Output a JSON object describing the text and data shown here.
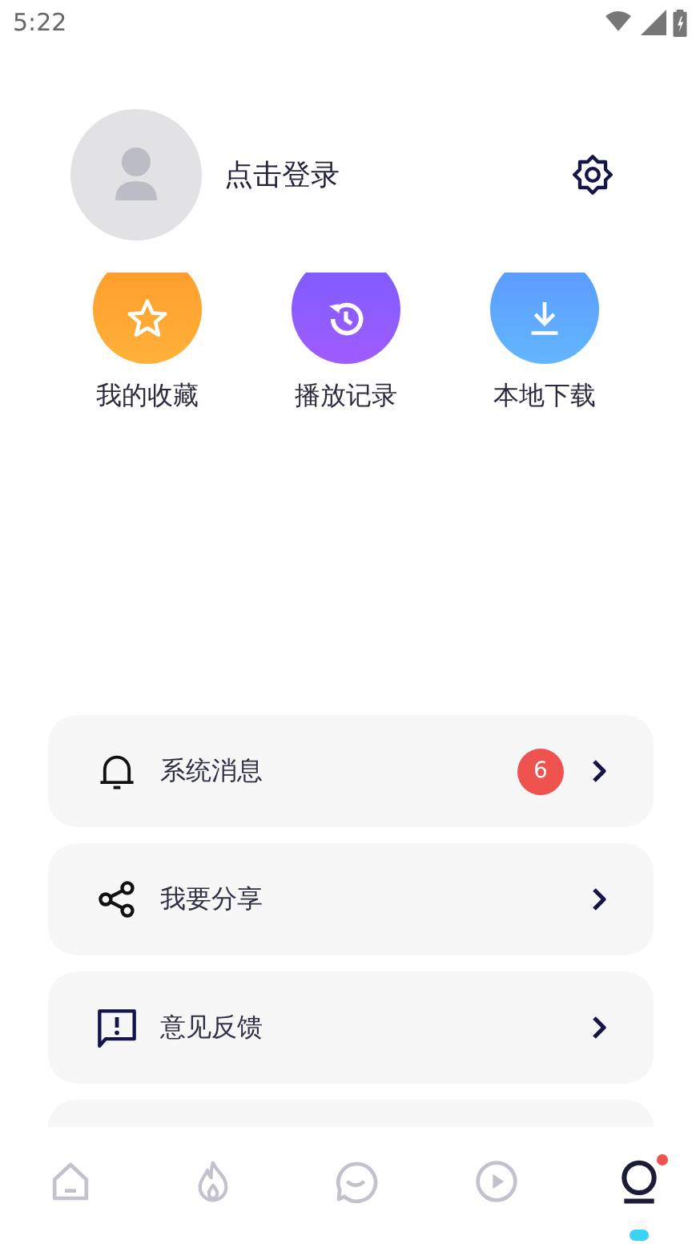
{
  "status_bar": {
    "time": "5:22"
  },
  "profile": {
    "login_label": "点击登录"
  },
  "shortcuts": [
    {
      "kind": "star",
      "label": "我的收藏"
    },
    {
      "kind": "history",
      "label": "播放记录"
    },
    {
      "kind": "download",
      "label": "本地下载"
    }
  ],
  "menu": [
    {
      "kind": "bell",
      "label": "系统消息",
      "badge": "6"
    },
    {
      "kind": "share",
      "label": "我要分享"
    },
    {
      "kind": "feedback",
      "label": "意见反馈"
    },
    {
      "kind": "partial"
    }
  ],
  "tabs": [
    {
      "kind": "home",
      "selected": false,
      "dot": false
    },
    {
      "kind": "fire",
      "selected": false,
      "dot": false
    },
    {
      "kind": "chat",
      "selected": false,
      "dot": false
    },
    {
      "kind": "play",
      "selected": false,
      "dot": false
    },
    {
      "kind": "me",
      "selected": true,
      "dot": true
    }
  ]
}
